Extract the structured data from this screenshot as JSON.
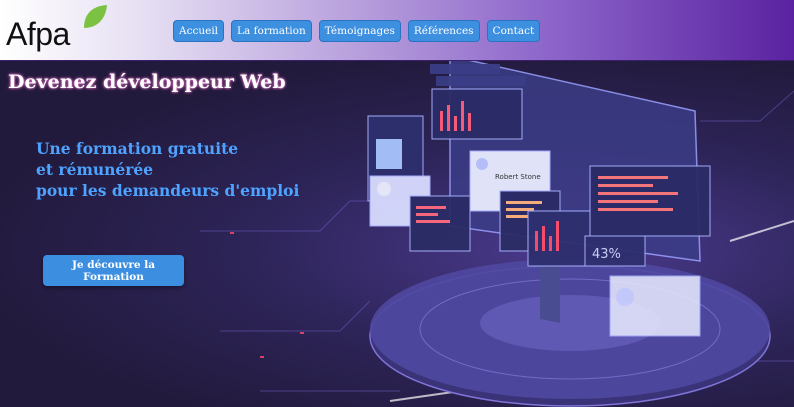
{
  "header": {
    "logo_text": "Afpa",
    "nav": [
      "Accueil",
      "La formation",
      "Témoignages",
      "Références",
      "Contact"
    ]
  },
  "hero": {
    "title": "Devenez développeur Web",
    "subtitle_lines": [
      "Une formation gratuite",
      "et rémunérée",
      "pour les demandeurs d'emploi"
    ],
    "cta_label": "Je découvre la Formation",
    "illustration": {
      "percent_label": "43%",
      "card_name": "Robert Stone"
    }
  },
  "colors": {
    "accent_blue": "#3d8fe0",
    "subtitle_blue": "#4da3ff",
    "logo_leaf": "#7cc242",
    "header_end": "#5a22a0"
  }
}
